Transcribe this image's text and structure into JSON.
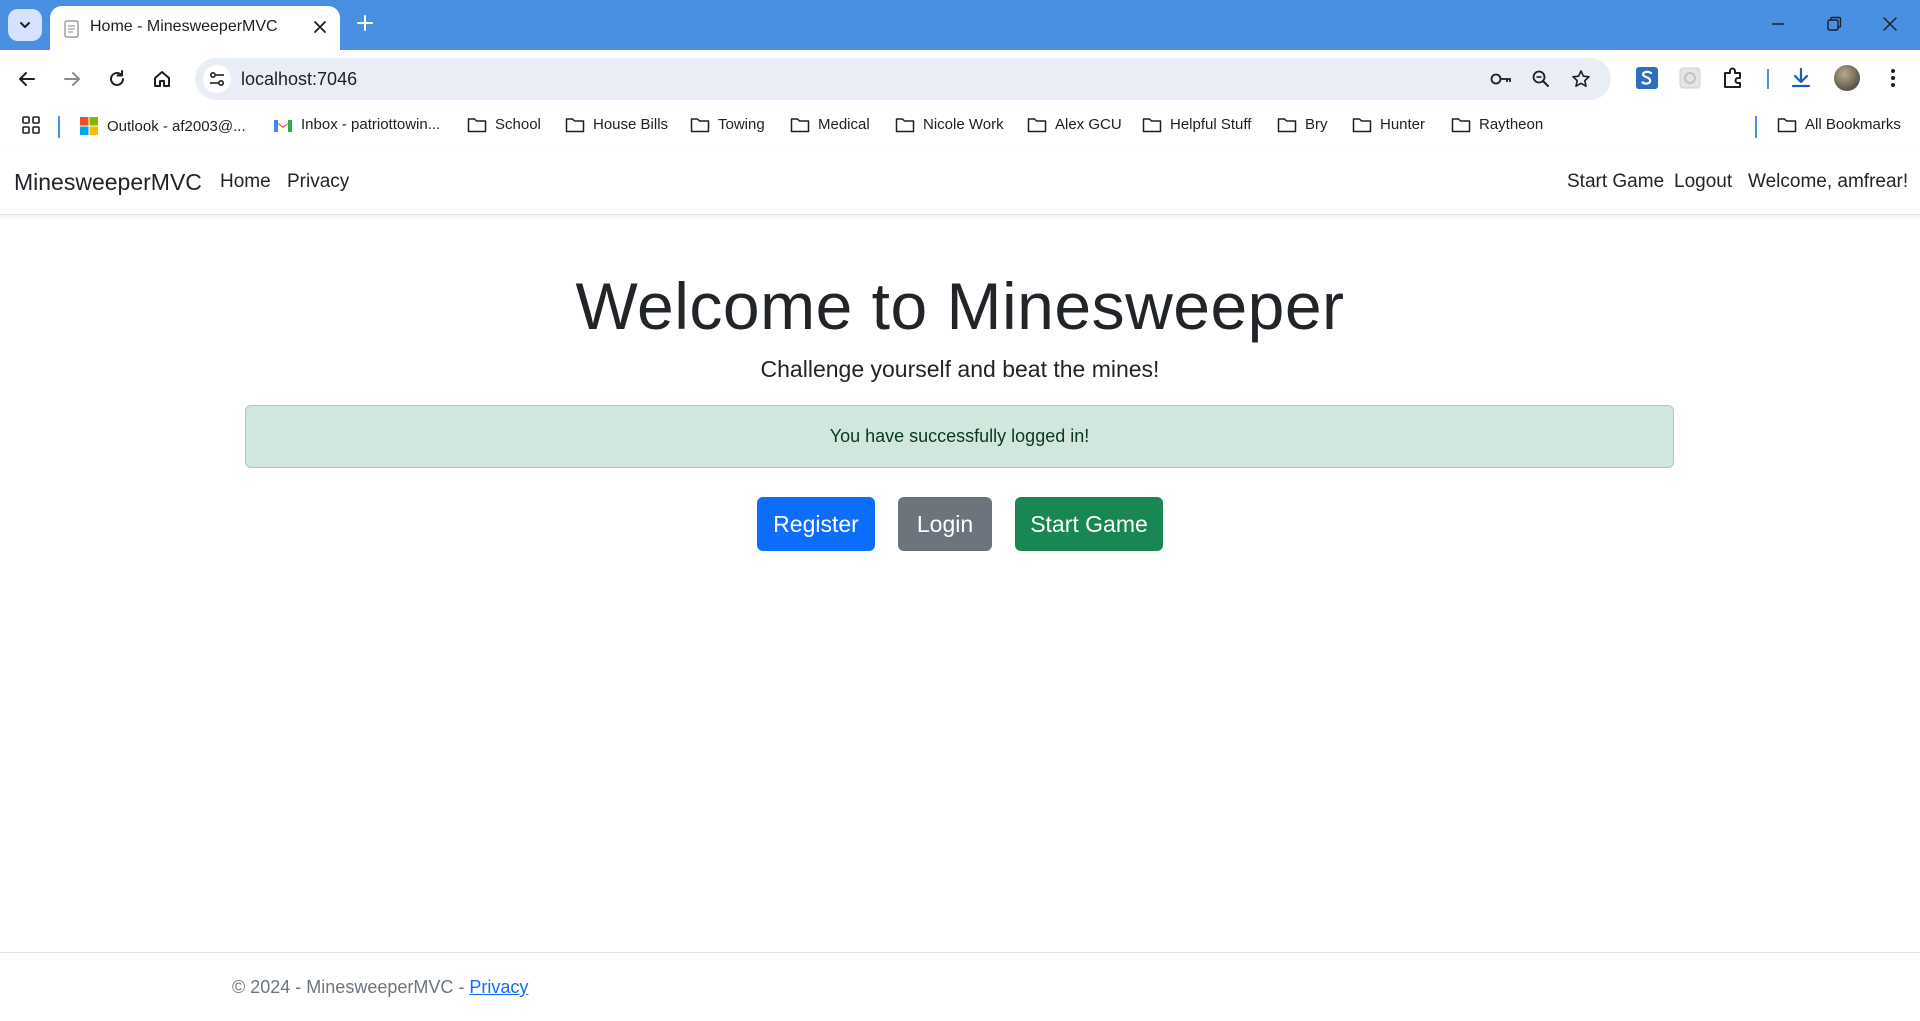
{
  "browser": {
    "tab_title": "Home - MinesweeperMVC",
    "address": "localhost:7046",
    "bookmarks": [
      {
        "label": "Outlook - af2003@...",
        "icon": "microsoft-icon"
      },
      {
        "label": "Inbox - patriottowin...",
        "icon": "gmail-icon"
      },
      {
        "label": "School",
        "icon": "folder-icon"
      },
      {
        "label": "House Bills",
        "icon": "folder-icon"
      },
      {
        "label": "Towing",
        "icon": "folder-icon"
      },
      {
        "label": "Medical",
        "icon": "folder-icon"
      },
      {
        "label": "Nicole Work",
        "icon": "folder-icon"
      },
      {
        "label": "Alex GCU",
        "icon": "folder-icon"
      },
      {
        "label": "Helpful Stuff",
        "icon": "folder-icon"
      },
      {
        "label": "Bry",
        "icon": "folder-icon"
      },
      {
        "label": "Hunter",
        "icon": "folder-icon"
      },
      {
        "label": "Raytheon",
        "icon": "folder-icon"
      }
    ],
    "all_bookmarks": "All Bookmarks"
  },
  "site": {
    "brand": "MinesweeperMVC",
    "nav_left": [
      "Home",
      "Privacy"
    ],
    "nav_right": [
      "Start Game",
      "Logout",
      "Welcome, amfrear!"
    ]
  },
  "hero": {
    "title": "Welcome to Minesweeper",
    "subtitle": "Challenge yourself and beat the mines!"
  },
  "alert": "You have successfully logged in!",
  "buttons": {
    "register": "Register",
    "login": "Login",
    "start_game": "Start Game"
  },
  "footer": {
    "text": "© 2024 - MinesweeperMVC - ",
    "link": "Privacy"
  },
  "colors": {
    "chrome_blue": "#4a90e2",
    "primary": "#0d6efd",
    "secondary": "#6c757d",
    "success": "#198754",
    "alert_bg": "#d1e7dd"
  }
}
